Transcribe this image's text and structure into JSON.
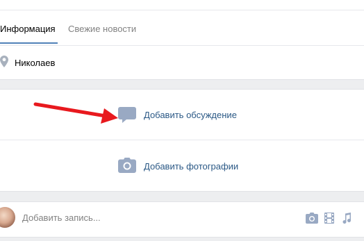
{
  "tabs": [
    {
      "label": "Информация",
      "active": true
    },
    {
      "label": "Свежие новости",
      "active": false
    }
  ],
  "location": {
    "icon": "map-pin-icon",
    "city": "Николаев"
  },
  "actions": {
    "discussion": {
      "icon": "chat-bubble-icon",
      "label": "Добавить обсуждение"
    },
    "photos": {
      "icon": "camera-icon",
      "label": "Добавить фотографии"
    }
  },
  "annotation": {
    "type": "arrow",
    "color": "#e8191e",
    "points_to": "Добавить обсуждение"
  },
  "post_box": {
    "placeholder": "Добавить запись...",
    "attach_icons": [
      "camera-icon",
      "film-icon",
      "music-note-icon"
    ]
  },
  "colors": {
    "accent": "#5181b8",
    "link": "#2a5885",
    "icon": "#99a9c3",
    "background": "#edeef0",
    "muted_text": "#828282"
  }
}
